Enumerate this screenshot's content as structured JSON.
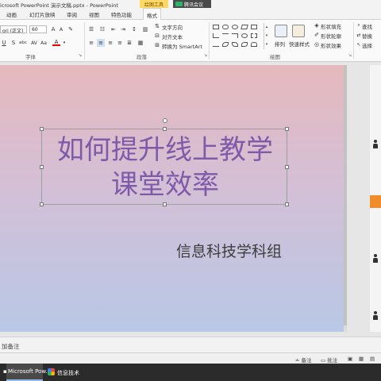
{
  "window": {
    "title": "icrosoft PowerPoint 演示文稿.pptx - PowerPoint",
    "contextual_tab": "绘图工具",
    "meeting_badge": "腾讯会议"
  },
  "tabs": [
    "动画",
    "幻灯片放映",
    "审阅",
    "视图",
    "特色功能",
    "格式"
  ],
  "ribbon": {
    "font": {
      "name": "ori (正文)",
      "size": "60",
      "group_label": "字体"
    },
    "paragraph": {
      "group_label": "段落",
      "text_direction": "文字方向",
      "align_text": "对齐文本",
      "convert_smartart": "转换为 SmartArt"
    },
    "drawing": {
      "group_label": "绘图",
      "arrange": "排列",
      "quick_styles": "快速样式",
      "shape_fill": "形状填充",
      "shape_outline": "形状轮廓",
      "shape_effects": "形状效果"
    },
    "editing": {
      "find": "查找",
      "replace": "替换",
      "select": "选择"
    }
  },
  "slide": {
    "title_line1": "如何提升线上教学",
    "title_line2": "课堂效率",
    "subtitle": "信息科技学科组"
  },
  "notes": {
    "placeholder": "加备注"
  },
  "statusbar": {
    "notes": "备注",
    "comments": "批注"
  },
  "taskbar": {
    "items": [
      {
        "label": "Microsoft Pow..."
      },
      {
        "label": "信息技术"
      }
    ]
  },
  "colors": {
    "title_text": "#7f5aa8",
    "slide_top": "#e6b9bd",
    "slide_bottom": "#b8c8e6",
    "meeting_green": "#2db26b",
    "orange_tab": "#f08c2a"
  }
}
